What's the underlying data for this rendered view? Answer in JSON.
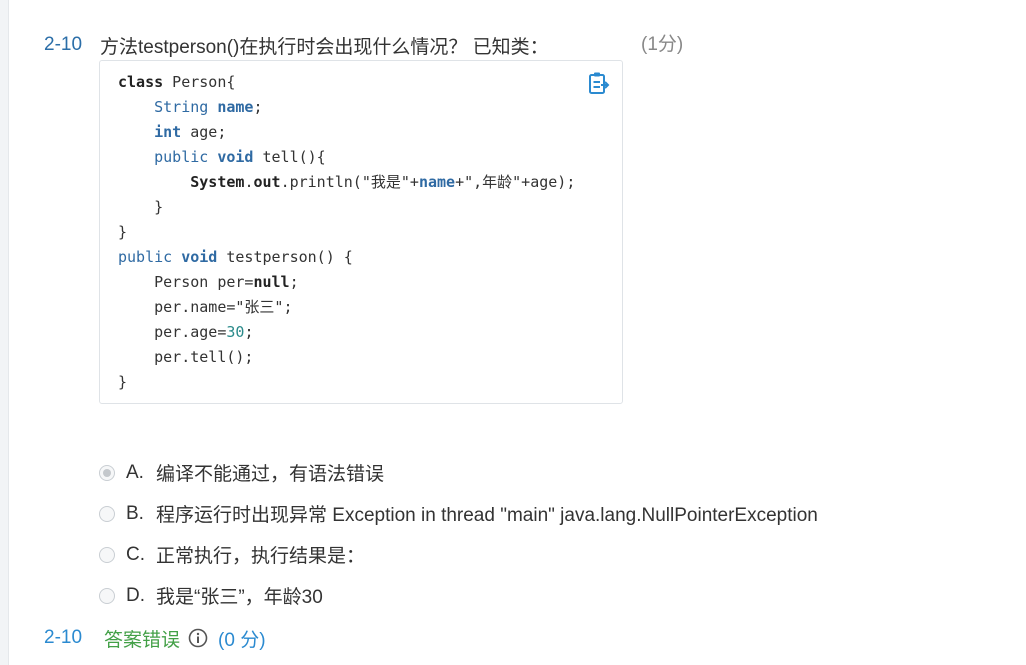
{
  "question": {
    "number": "2-10",
    "text": "方法testperson()在执行时会出现什么情况？ 已知类：",
    "score": "(1分)"
  },
  "code": {
    "l1_kw": "class",
    "l1_rest": " Person{",
    "l2_type": "String",
    "l2_name": "name",
    "l2_end": ";",
    "l3_kw": "int",
    "l3_rest": " age;",
    "l4_kw1": "public",
    "l4_kw2": "void",
    "l4_rest": " tell(){",
    "l5_sys": "System",
    "l5_dot1": ".",
    "l5_out": "out",
    "l5_mid": ".println(\"我是\"+",
    "l5_name": "name",
    "l5_end": "+\",年龄\"+age);",
    "l6": "}",
    "l7": "}",
    "l8_kw1": "public",
    "l8_kw2": "void",
    "l8_rest": " testperson() {",
    "l9_a": "Person per=",
    "l9_null": "null",
    "l9_b": ";",
    "l10": "per.name=\"张三\";",
    "l11_a": "per.age=",
    "l11_num": "30",
    "l11_b": ";",
    "l12": "per.tell();",
    "l13": "}"
  },
  "options": [
    {
      "key": "A.",
      "text": "编译不能通过，有语法错误"
    },
    {
      "key": "B.",
      "text": "程序运行时出现异常 Exception in thread \"main\" java.lang.NullPointerException"
    },
    {
      "key": "C.",
      "text": "正常执行，执行结果是："
    },
    {
      "key": "D.",
      "text": "我是“张三”，年龄30"
    }
  ],
  "result": {
    "number": "2-10",
    "status": "答案错误",
    "score": "(0 分)"
  },
  "colors": {
    "accent_blue": "#2b8ad0",
    "wrong_green": "#43a047",
    "keyword_blue": "#2f6aa3"
  },
  "icons": {
    "copy": "copy-icon",
    "info": "info-icon"
  }
}
